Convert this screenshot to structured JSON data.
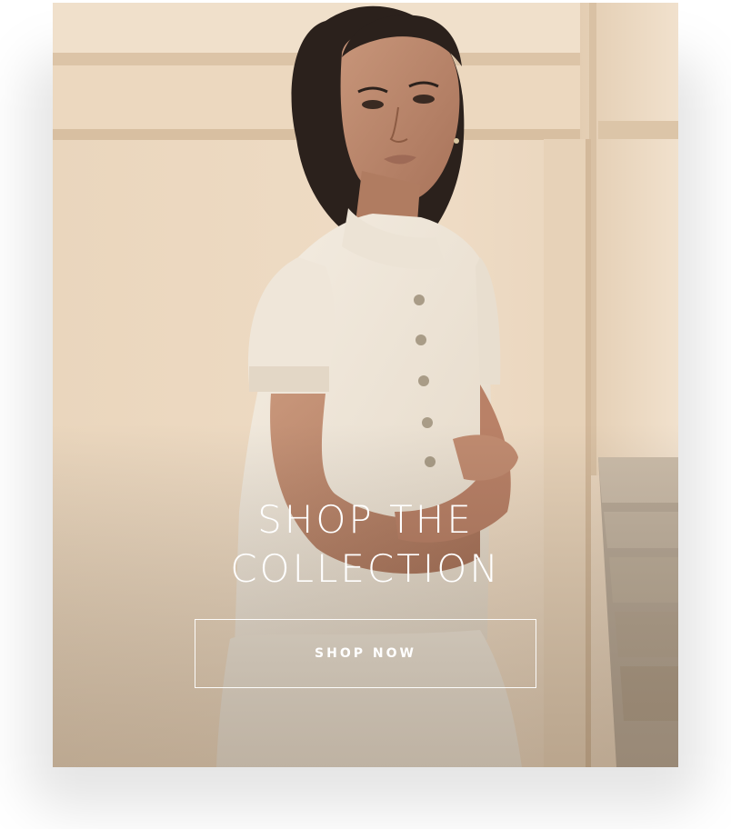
{
  "hero": {
    "image_alt": "model-in-cream-knit-cardigan-and-skirt",
    "headline_line1": "SHOP THE",
    "headline_line2": "COLLECTION",
    "cta_label": "SHOP NOW",
    "colors": {
      "text": "#ffffff",
      "wall": "#ecd9c2",
      "garment": "#efe6d8",
      "skin": "#b88366",
      "hair": "#2b211c",
      "stairs": "#b9aa98"
    }
  }
}
